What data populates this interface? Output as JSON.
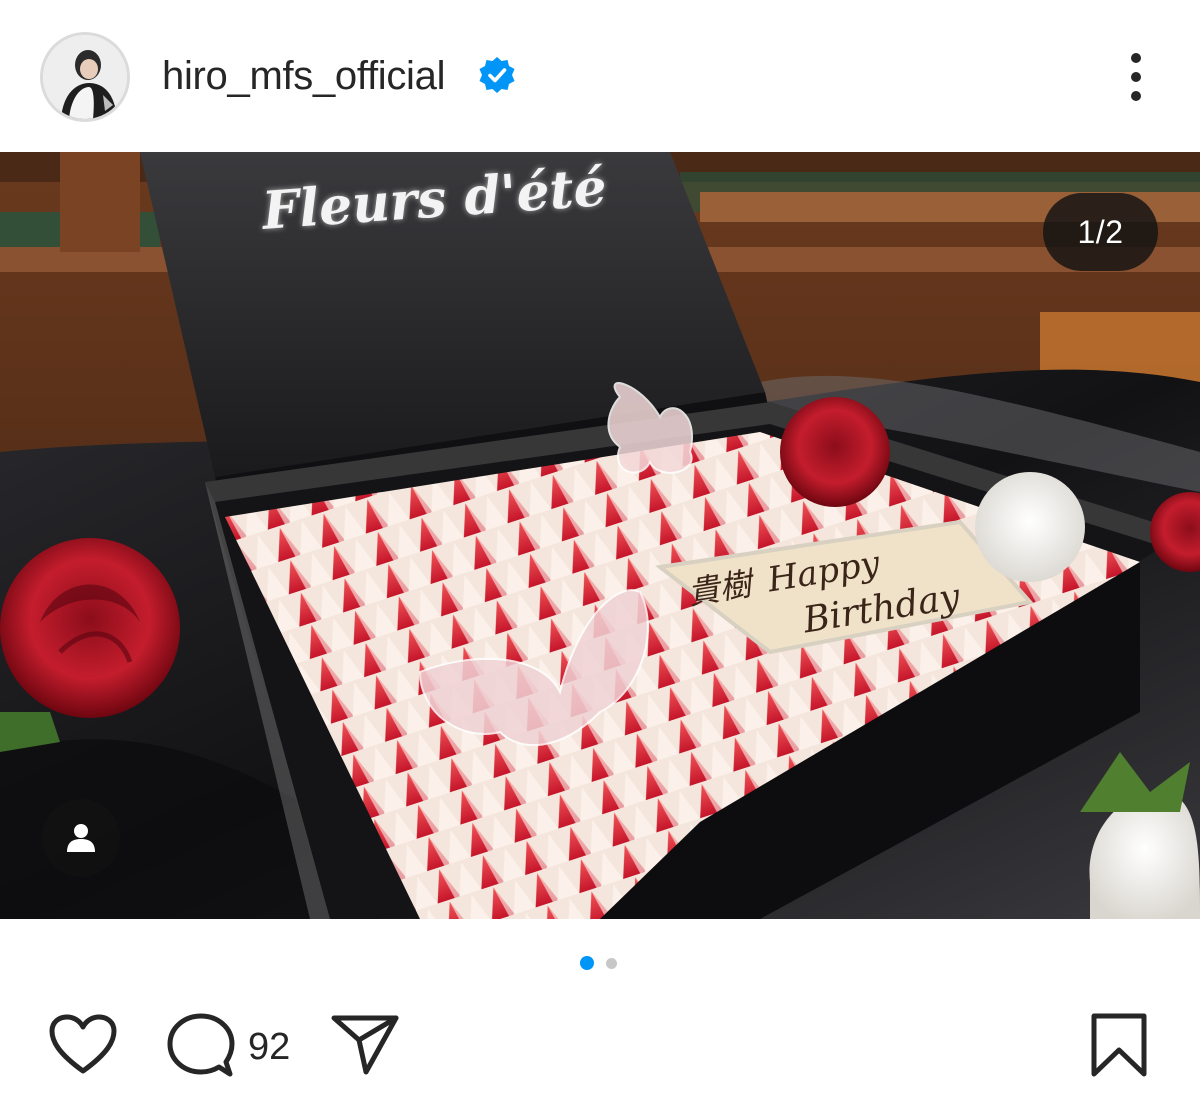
{
  "post": {
    "username": "hiro_mfs_official",
    "verified": true,
    "avatar_icon": "profile-avatar",
    "more_icon": "more-vertical-icon"
  },
  "media": {
    "counter": "1/2",
    "current_slide": 1,
    "total_slides": 2,
    "box_lid_text": "Fleurs d'été",
    "plaque_text_line1": "貴樹",
    "plaque_text_line2": "Happy",
    "plaque_text_line3": "Birthday",
    "tag_icon": "user-tag-icon"
  },
  "actions": {
    "like_icon": "heart-icon",
    "comment_icon": "comment-icon",
    "comment_count": "92",
    "share_icon": "paper-plane-icon",
    "save_icon": "bookmark-icon"
  },
  "colors": {
    "accent_blue": "#0095f6",
    "verified_blue": "#0095f6",
    "text": "#262626"
  }
}
